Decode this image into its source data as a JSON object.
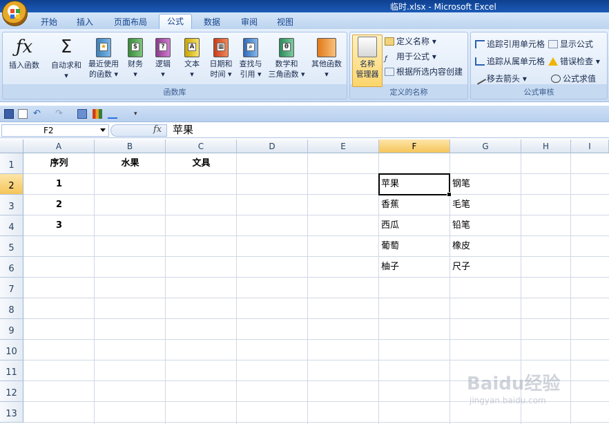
{
  "window": {
    "title": "临时.xlsx - Microsoft Excel"
  },
  "tabs": [
    {
      "label": "开始"
    },
    {
      "label": "插入"
    },
    {
      "label": "页面布局"
    },
    {
      "label": "公式"
    },
    {
      "label": "数据"
    },
    {
      "label": "审阅"
    },
    {
      "label": "视图"
    }
  ],
  "active_tab": "公式",
  "ribbon": {
    "function_library": {
      "group_label": "函数库",
      "insert_function": "插入函数",
      "autosum": "自动求和",
      "recent_1": "最近使用",
      "recent_2": "的函数",
      "financial": "财务",
      "logical": "逻辑",
      "text": "文本",
      "datetime_1": "日期和",
      "datetime_2": "时间",
      "lookup_1": "查找与",
      "lookup_2": "引用",
      "math_1": "数学和",
      "math_2": "三角函数",
      "more": "其他函数"
    },
    "defined_names": {
      "group_label": "定义的名称",
      "name_manager_1": "名称",
      "name_manager_2": "管理器",
      "define_name": "定义名称",
      "use_in_formula": "用于公式",
      "create_from_selection": "根据所选内容创建"
    },
    "formula_auditing": {
      "group_label": "公式审核",
      "trace_precedents": "追踪引用单元格",
      "trace_dependents": "追踪从属单元格",
      "remove_arrows": "移去箭头",
      "show_formulas": "显示公式",
      "error_checking": "错误检查",
      "evaluate_formula": "公式求值"
    }
  },
  "formula_bar": {
    "name_box": "F2",
    "fx": "fx",
    "content": "苹果"
  },
  "columns": [
    "A",
    "B",
    "C",
    "D",
    "E",
    "F",
    "G",
    "H",
    "I"
  ],
  "rows": [
    "1",
    "2",
    "3",
    "4",
    "5",
    "6",
    "7",
    "8",
    "9",
    "10",
    "11",
    "12",
    "13"
  ],
  "selected_column": "F",
  "selected_row": "2",
  "cells": {
    "A1": "序列",
    "B1": "水果",
    "C1": "文具",
    "A2": "1",
    "A3": "2",
    "A4": "3",
    "F2": "苹果",
    "F3": "香蕉",
    "F4": "西瓜",
    "F5": "葡萄",
    "F6": "柚子",
    "G2": "钢笔",
    "G3": "毛笔",
    "G4": "铅笔",
    "G5": "橡皮",
    "G6": "尺子"
  },
  "watermark": {
    "logo": "Baidu经验",
    "url": "jingyan.baidu.com"
  },
  "colors": {
    "ribbon": "#dfeaf8",
    "selected_header": "#f5c55a",
    "title_bar": "#1c5cb8"
  }
}
